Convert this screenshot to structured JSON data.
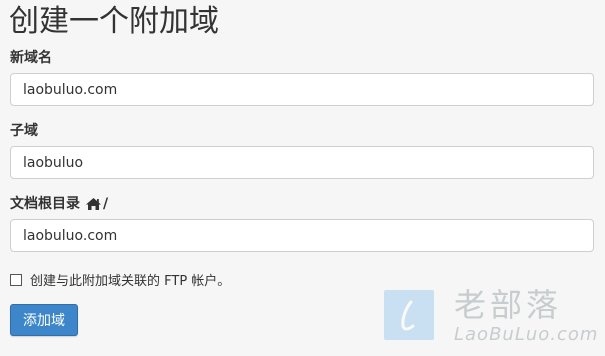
{
  "page": {
    "title": "创建一个附加域"
  },
  "form": {
    "new_domain": {
      "label": "新域名",
      "value": "laobuluo.com"
    },
    "subdomain": {
      "label": "子域",
      "value": "laobuluo"
    },
    "document_root": {
      "label": "文档根目录",
      "suffix": "/",
      "icon": "home-icon",
      "value": "laobuluo.com"
    },
    "ftp_checkbox": {
      "label": "创建与此附加域关联的 FTP 帐户。",
      "checked": false
    },
    "submit_label": "添加域"
  },
  "watermark": {
    "brand_cn": "老部落",
    "brand_en": "LaoBuLuo.com"
  },
  "colors": {
    "primary": "#3c86c9",
    "background": "#f6f6f6",
    "border": "#cfcfcf",
    "text": "#333333"
  }
}
